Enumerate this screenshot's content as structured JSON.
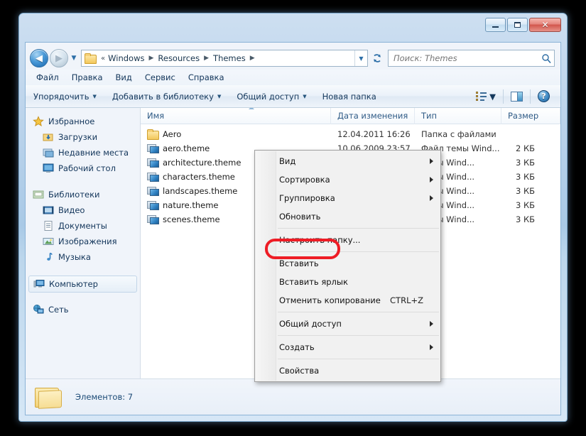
{
  "window": {
    "buttons": {
      "minimize": "minimize-icon",
      "maximize": "maximize-icon",
      "close": "✕"
    }
  },
  "navigation": {
    "back_tooltip": "Назад",
    "forward_tooltip": "Вперед",
    "recent_dropdown": "chevron-down-icon",
    "refresh": "refresh-icon"
  },
  "address": {
    "leading_chevron": "«",
    "crumbs": [
      "Windows",
      "Resources",
      "Themes"
    ],
    "separator": "▶",
    "dropdown": "▼"
  },
  "search": {
    "placeholder": "Поиск: Themes",
    "value": "",
    "icon": "search-icon"
  },
  "menubar": {
    "items": [
      {
        "label": "Файл"
      },
      {
        "label": "Правка"
      },
      {
        "label": "Вид"
      },
      {
        "label": "Сервис"
      },
      {
        "label": "Справка"
      }
    ]
  },
  "commandbar": {
    "buttons": [
      {
        "label": "Упорядочить",
        "caret": "▼"
      },
      {
        "label": "Добавить в библиотеку",
        "caret": "▼"
      },
      {
        "label": "Общий доступ",
        "caret": "▼"
      },
      {
        "label": "Новая папка",
        "caret": ""
      }
    ],
    "view_caret": "▼",
    "icons": {
      "view_mode": "view-mode-icon",
      "preview_pane": "preview-pane-icon",
      "help": "?"
    }
  },
  "sidebar": {
    "groups": [
      {
        "header": {
          "label": "Избранное",
          "icon": "star-icon"
        },
        "items": [
          {
            "label": "Загрузки",
            "icon": "downloads-icon"
          },
          {
            "label": "Недавние места",
            "icon": "recent-places-icon"
          },
          {
            "label": "Рабочий стол",
            "icon": "desktop-icon"
          }
        ]
      },
      {
        "header": {
          "label": "Библиотеки",
          "icon": "libraries-icon"
        },
        "items": [
          {
            "label": "Видео",
            "icon": "video-icon"
          },
          {
            "label": "Документы",
            "icon": "documents-icon"
          },
          {
            "label": "Изображения",
            "icon": "pictures-icon"
          },
          {
            "label": "Музыка",
            "icon": "music-icon"
          }
        ]
      },
      {
        "header": {
          "label": "Компьютер",
          "icon": "computer-icon",
          "selected": true
        },
        "items": []
      },
      {
        "header": {
          "label": "Сеть",
          "icon": "network-icon"
        },
        "items": []
      }
    ]
  },
  "filelist": {
    "columns": [
      {
        "label": "Имя"
      },
      {
        "label": "Дата изменения"
      },
      {
        "label": "Тип"
      },
      {
        "label": "Размер"
      }
    ],
    "sort_column": "Имя",
    "rows": [
      {
        "name": "Aero",
        "date": "12.04.2011 16:26",
        "type": "Папка с файлами",
        "size": "",
        "icon": "folder-icon"
      },
      {
        "name": "aero.theme",
        "date": "10.06.2009 23:57",
        "type": "Файл темы Wind...",
        "size": "2 КБ",
        "icon": "theme-file-icon"
      },
      {
        "name": "architecture.theme",
        "date": "",
        "type": "темы Wind...",
        "size": "3 КБ",
        "icon": "theme-file-icon"
      },
      {
        "name": "characters.theme",
        "date": "",
        "type": "темы Wind...",
        "size": "3 КБ",
        "icon": "theme-file-icon"
      },
      {
        "name": "landscapes.theme",
        "date": "",
        "type": "темы Wind...",
        "size": "3 КБ",
        "icon": "theme-file-icon"
      },
      {
        "name": "nature.theme",
        "date": "",
        "type": "темы Wind...",
        "size": "3 КБ",
        "icon": "theme-file-icon"
      },
      {
        "name": "scenes.theme",
        "date": "",
        "type": "темы Wind...",
        "size": "3 КБ",
        "icon": "theme-file-icon"
      }
    ]
  },
  "context_menu": {
    "items": [
      {
        "label": "Вид",
        "accel": "",
        "submenu": true,
        "type": "item"
      },
      {
        "label": "Сортировка",
        "accel": "",
        "submenu": true,
        "type": "item"
      },
      {
        "label": "Группировка",
        "accel": "",
        "submenu": true,
        "type": "item"
      },
      {
        "label": "Обновить",
        "accel": "",
        "submenu": false,
        "type": "item"
      },
      {
        "type": "separator"
      },
      {
        "label": "Настроить папку...",
        "accel": "",
        "submenu": false,
        "type": "item"
      },
      {
        "type": "separator"
      },
      {
        "label": "Вставить",
        "accel": "",
        "submenu": false,
        "type": "item",
        "highlighted": true
      },
      {
        "label": "Вставить ярлык",
        "accel": "",
        "submenu": false,
        "type": "item"
      },
      {
        "label": "Отменить копирование",
        "accel": "CTRL+Z",
        "submenu": false,
        "type": "item"
      },
      {
        "type": "separator"
      },
      {
        "label": "Общий доступ",
        "accel": "",
        "submenu": true,
        "type": "item"
      },
      {
        "type": "separator"
      },
      {
        "label": "Создать",
        "accel": "",
        "submenu": true,
        "type": "item"
      },
      {
        "type": "separator"
      },
      {
        "label": "Свойства",
        "accel": "",
        "submenu": false,
        "type": "item"
      }
    ]
  },
  "statusbar": {
    "text": "Элементов: 7",
    "icon": "folder-large-icon"
  },
  "annotation": {
    "highlight_color": "#ee1c25",
    "target": "Вставить"
  }
}
